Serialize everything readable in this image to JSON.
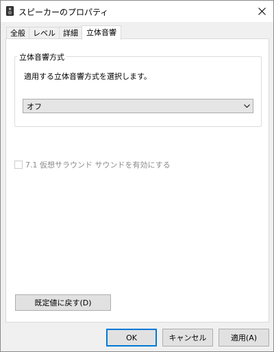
{
  "window": {
    "title": "スピーカーのプロパティ",
    "close_symbol": "✕"
  },
  "tabs": [
    {
      "label": "全般",
      "active": false
    },
    {
      "label": "レベル",
      "active": false
    },
    {
      "label": "詳細",
      "active": false
    },
    {
      "label": "立体音響",
      "active": true
    }
  ],
  "spatial": {
    "group_title": "立体音響方式",
    "description": "適用する立体音響方式を選択します。",
    "format_value": "オフ",
    "virtual_surround_label": "7.1 仮想サラウンド サウンドを有効にする",
    "virtual_surround_checked": false,
    "virtual_surround_enabled": false,
    "restore_label": "既定値に戻す(D)"
  },
  "footer": {
    "ok_label": "OK",
    "cancel_label": "キャンセル",
    "apply_label": "適用(A)"
  },
  "colors": {
    "focus_border": "#0078d7",
    "window_bg": "#f0f0f0",
    "disabled_text": "#8a8a8a"
  },
  "icons": {
    "title": "speaker-icon",
    "close": "close-icon",
    "dropdown": "chevron-down-icon"
  }
}
